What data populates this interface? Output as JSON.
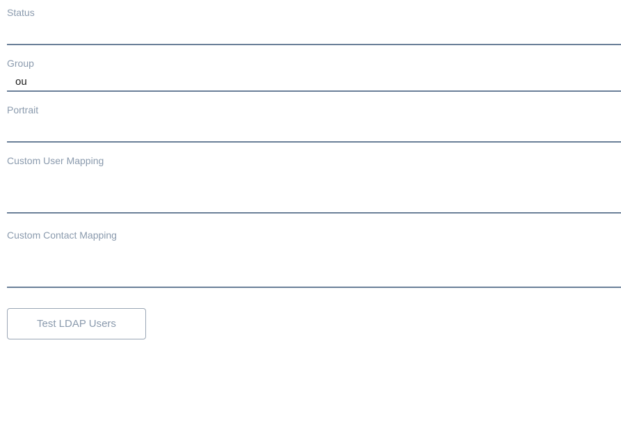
{
  "fields": {
    "status": {
      "label": "Status",
      "value": ""
    },
    "group": {
      "label": "Group",
      "value": "ou"
    },
    "portrait": {
      "label": "Portrait",
      "value": ""
    },
    "customUserMapping": {
      "label": "Custom User Mapping",
      "value": ""
    },
    "customContactMapping": {
      "label": "Custom Contact Mapping",
      "value": ""
    }
  },
  "buttons": {
    "testLdap": "Test LDAP Users"
  }
}
